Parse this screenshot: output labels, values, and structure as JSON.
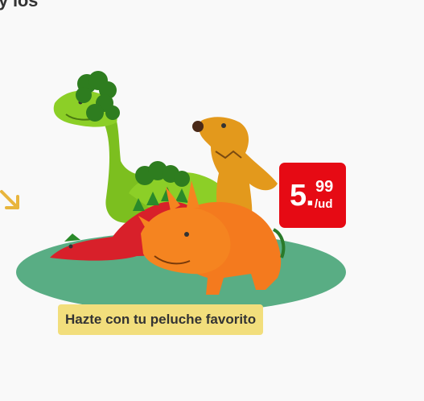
{
  "headline": {
    "text": "y los"
  },
  "promo": {
    "price_integer": "5.",
    "price_cents": "99",
    "price_unit": "/ud",
    "tagline": "Hazte con tu peluche favorito"
  },
  "colors": {
    "background": "#f9f9f9",
    "oval": "#59ad84",
    "badge": "#e60a14",
    "tag": "#f2de7c",
    "arrow": "#e8b53d"
  }
}
